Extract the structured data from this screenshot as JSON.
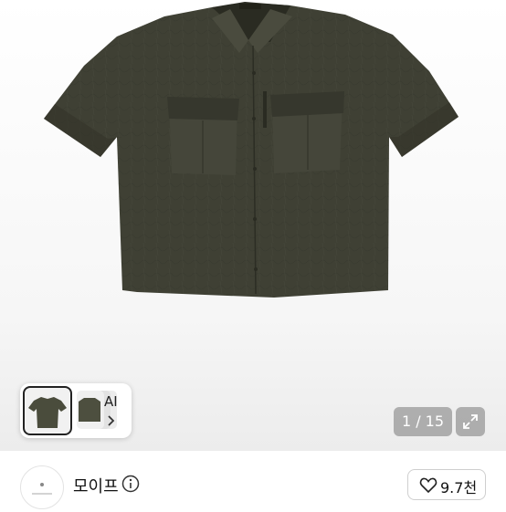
{
  "gallery": {
    "ai_label": "AI",
    "page_counter": "1 / 15",
    "shirt_color": "#3f4034",
    "background_color": "#f4f4f4"
  },
  "seller": {
    "name": "모이프",
    "like_count": "9.7천"
  },
  "icons": {
    "info": "info-circle-icon",
    "heart": "heart-outline-icon",
    "expand": "expand-arrows-icon",
    "chevron": "chevron-right-icon"
  }
}
